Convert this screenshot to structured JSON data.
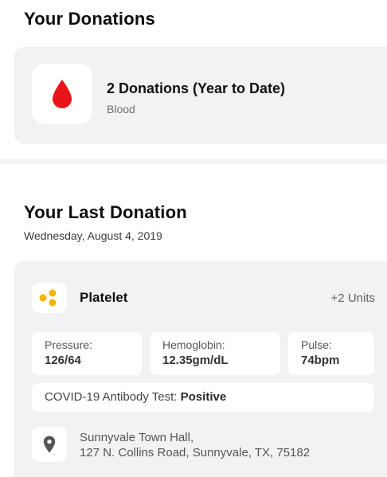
{
  "donations": {
    "title": "Your Donations",
    "ytd_count": "2 Donations (Year to Date)",
    "type": "Blood",
    "icon": "blood-drop-icon",
    "icon_color": "#e8141a"
  },
  "last_donation": {
    "title": "Your Last Donation",
    "date": "Wednesday, August 4, 2019",
    "product": {
      "icon": "platelet-icon",
      "icon_color": "#f5b400",
      "label": "Platelet",
      "units": "+2 Units"
    },
    "stats": {
      "pressure": {
        "label": "Pressure:",
        "value": "126/64"
      },
      "hemoglobin": {
        "label": "Hemoglobin:",
        "value": "12.35gm/dL"
      },
      "pulse": {
        "label": "Pulse:",
        "value": "74bpm"
      }
    },
    "covid": {
      "label": "COVID-19 Antibody Test:",
      "result": "Positive"
    },
    "location": {
      "icon": "location-pin-icon",
      "name": "Sunnyvale Town Hall,",
      "address": "127 N. Collins Road, Sunnyvale, TX, 75182"
    }
  }
}
